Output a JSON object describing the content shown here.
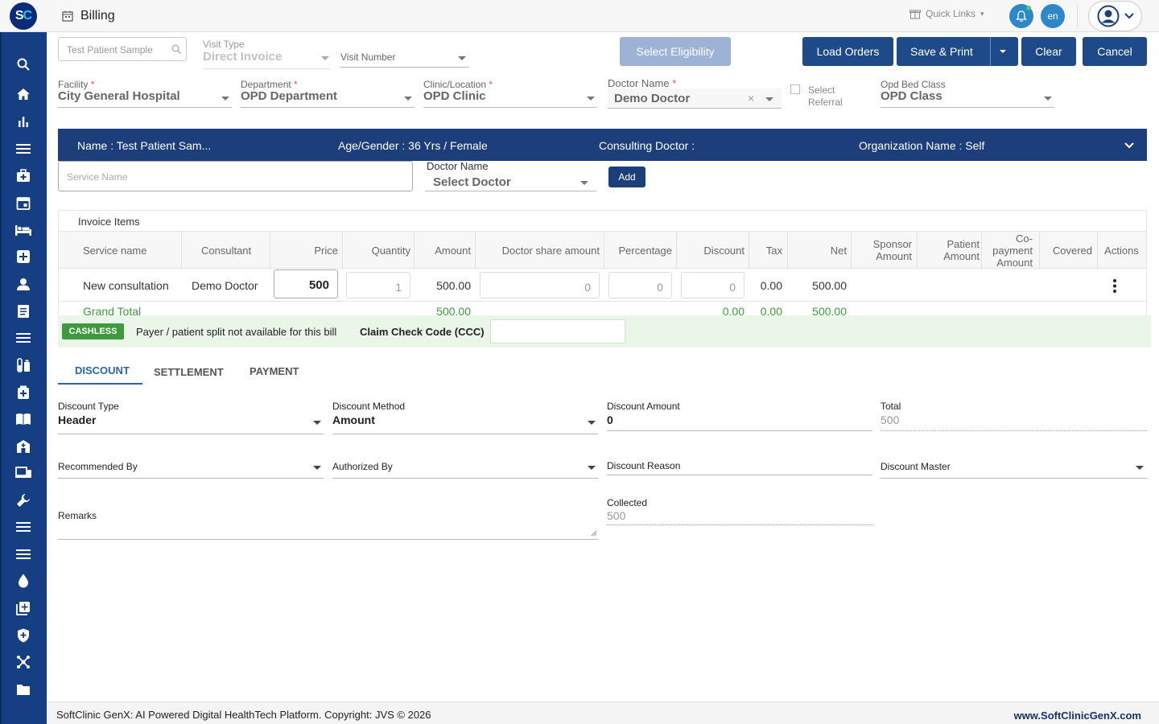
{
  "app": {
    "logo_text": "SC",
    "page_title": "Billing"
  },
  "topbar": {
    "quick_links": "Quick Links",
    "language": "en"
  },
  "colors": {
    "primary": "#1e4a8a",
    "sidebar": "#163e82",
    "accent_green": "#3d9b3d",
    "badge_blue": "#2d87c8"
  },
  "sidebar_icons": [
    "search-icon",
    "home-icon",
    "bar-chart-icon",
    "menu-icon",
    "medical-bag-icon",
    "calendar-icon",
    "bed-icon",
    "plus-square-icon",
    "user-icon",
    "document-icon",
    "list-icon",
    "lab-icon",
    "pharmacy-icon",
    "book-icon",
    "hospital-icon",
    "devices-icon",
    "wrench-icon",
    "list-icon",
    "list-icon",
    "blood-drop-icon",
    "add-box-icon",
    "shield-icon",
    "network-icon",
    "folder-icon"
  ],
  "header": {
    "patient_search": "Test Patient Sample",
    "visit_type_label": "Visit Type",
    "visit_type_value": "Direct Invoice",
    "visit_number_placeholder": "Visit Number",
    "select_eligibility": "Select Eligibility",
    "load_orders": "Load Orders",
    "save_print": "Save & Print",
    "clear": "Clear",
    "cancel": "Cancel",
    "facility_label": "Facility",
    "facility_value": "City General Hospital",
    "department_label": "Department",
    "department_value": "OPD Department",
    "clinic_label": "Clinic/Location",
    "clinic_value": "OPD Clinic",
    "doctor_label": "Doctor Name",
    "doctor_value": "Demo Doctor",
    "select_referral": "Select Referral",
    "bed_class_label": "Opd Bed Class",
    "bed_class_value": "OPD Class"
  },
  "banner": {
    "name": "Name :  Test Patient Sam...",
    "age_gender": "Age/Gender :  36 Yrs / Female",
    "consulting": "Consulting Doctor :",
    "organization": "Organization Name :  Self"
  },
  "add_service": {
    "service_placeholder": "Service Name",
    "doctor_label": "Doctor Name",
    "doctor_placeholder": "Select Doctor",
    "add": "Add"
  },
  "invoice": {
    "title": "Invoice Items",
    "columns": [
      "Service name",
      "Consultant",
      "Price",
      "Quantity",
      "Amount",
      "Doctor share amount",
      "Percentage",
      "Discount",
      "Tax",
      "Net",
      "Sponsor Amount",
      "Patient Amount",
      "Co-payment Amount",
      "Covered",
      "Actions"
    ],
    "row": {
      "service": "New consultation",
      "consultant": "Demo Doctor",
      "price": "500",
      "quantity": "1",
      "amount": "500.00",
      "doctor_share": "0",
      "percentage": "0",
      "discount": "0",
      "tax": "0.00",
      "net": "500.00"
    },
    "grand_total": {
      "label": "Grand Total",
      "amount": "500.00",
      "discount": "0.00",
      "tax": "0.00",
      "net": "500.00"
    }
  },
  "cashless": {
    "badge": "CASHLESS",
    "message": "Payer / patient split not available for this bill",
    "ccc_label": "Claim Check Code (CCC)"
  },
  "tabs": [
    "DISCOUNT",
    "SETTLEMENT",
    "PAYMENT"
  ],
  "discount": {
    "type_label": "Discount Type",
    "type_value": "Header",
    "method_label": "Discount Method",
    "method_value": "Amount",
    "amount_label": "Discount Amount",
    "amount_value": "0",
    "total_label": "Total",
    "total_value": "500",
    "recommended_by": "Recommended By",
    "authorized_by": "Authorized By",
    "reason": "Discount Reason",
    "master": "Discount Master",
    "remarks": "Remarks",
    "collected_label": "Collected",
    "collected_value": "500"
  },
  "footer": {
    "copyright": "SoftClinic GenX: AI Powered Digital HealthTech Platform. Copyright: JVS © 2026",
    "website": "www.SoftClinicGenX.com"
  }
}
